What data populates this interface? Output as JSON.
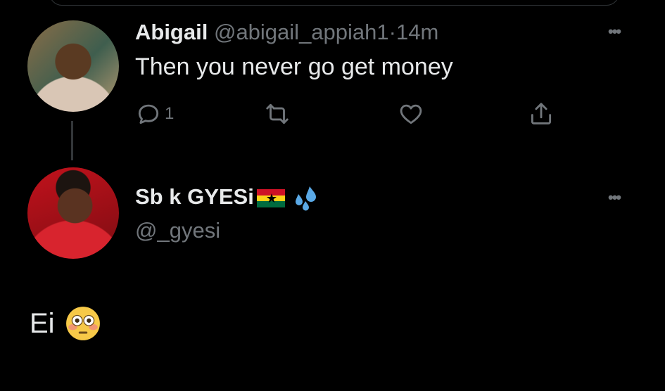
{
  "tweet1": {
    "name": "Abigail",
    "handle": "@abigail_appiah1",
    "separator": "·",
    "time": "14m",
    "text": "Then you never go get money",
    "reply_count": "1"
  },
  "tweet2": {
    "name": "Sb k GYESi",
    "handle": "@_gyesi",
    "body_text": "Ei"
  },
  "icons": [
    "more-icon",
    "reply-icon",
    "retweet-icon",
    "like-icon",
    "share-icon",
    "ghana-flag-icon",
    "sweat-droplets-icon",
    "flushed-face-icon"
  ],
  "colors": {
    "background": "#000000",
    "text": "#e7e9ea",
    "muted": "#71767b",
    "thread_line": "#333639"
  }
}
